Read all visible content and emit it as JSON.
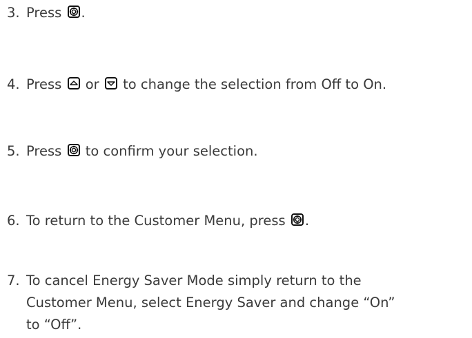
{
  "steps": [
    {
      "number": "3.",
      "before": "Press",
      "icon": "select-icon",
      "after": "."
    },
    {
      "number": "4.",
      "before": "Press",
      "icon1": "up-icon",
      "middle": "or",
      "icon2": "down-icon",
      "after": "to change the selection from Off to On."
    },
    {
      "number": "5.",
      "before": "Press",
      "icon": "select-icon",
      "after": "to confirm your selection."
    },
    {
      "number": "6.",
      "before": "To return to the Customer Menu, press",
      "icon": "select-icon",
      "after": "."
    },
    {
      "number": "7.",
      "lines": [
        "To cancel Energy Saver Mode simply return to the",
        "Customer Menu, select Energy Saver and change “On”",
        "to “Off”."
      ]
    }
  ]
}
